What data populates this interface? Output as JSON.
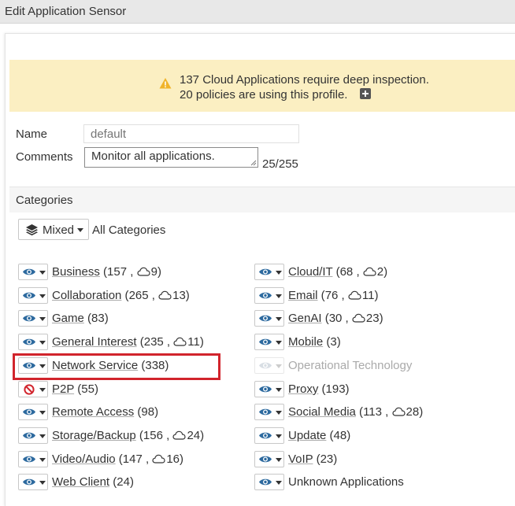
{
  "window": {
    "title": "Edit Application Sensor"
  },
  "banner": {
    "line1": "137 Cloud Applications require deep inspection.",
    "line2": "20 policies are using this profile.",
    "icon": "warning-icon",
    "accent": "#f0b429"
  },
  "form": {
    "name_label": "Name",
    "name_placeholder": "default",
    "comments_label": "Comments",
    "comments_value": "Monitor all applications.",
    "char_count": "25/255"
  },
  "categories": {
    "heading": "Categories",
    "mixed_label": "Mixed",
    "all_label": "All Categories",
    "left": [
      {
        "name": "Business",
        "count": "157",
        "cloud": "9",
        "action": "monitor"
      },
      {
        "name": "Collaboration",
        "count": "265",
        "cloud": "13",
        "action": "monitor"
      },
      {
        "name": "Game",
        "count": "83",
        "action": "monitor"
      },
      {
        "name": "General Interest",
        "count": "235",
        "cloud": "11",
        "action": "monitor"
      },
      {
        "name": "Network Service",
        "count": "338",
        "action": "monitor",
        "highlighted": true
      },
      {
        "name": "P2P",
        "count": "55",
        "action": "block"
      },
      {
        "name": "Remote Access",
        "count": "98",
        "action": "monitor"
      },
      {
        "name": "Storage/Backup",
        "count": "156",
        "cloud": "24",
        "action": "monitor"
      },
      {
        "name": "Video/Audio",
        "count": "147",
        "cloud": "16",
        "action": "monitor"
      },
      {
        "name": "Web Client",
        "count": "24",
        "action": "monitor"
      }
    ],
    "right": [
      {
        "name": "Cloud/IT",
        "count": "68",
        "cloud": "2",
        "action": "monitor"
      },
      {
        "name": "Email",
        "count": "76",
        "cloud": "11",
        "action": "monitor"
      },
      {
        "name": "GenAI",
        "count": "30",
        "cloud": "23",
        "action": "monitor"
      },
      {
        "name": "Mobile",
        "count": "3",
        "action": "monitor"
      },
      {
        "name": "Operational Technology",
        "action": "disabled"
      },
      {
        "name": "Proxy",
        "count": "193",
        "action": "monitor"
      },
      {
        "name": "Social Media",
        "count": "113",
        "cloud": "28",
        "action": "monitor"
      },
      {
        "name": "Update",
        "count": "48",
        "action": "monitor"
      },
      {
        "name": "VoIP",
        "count": "23",
        "action": "monitor"
      },
      {
        "name": "Unknown Applications",
        "action": "monitor",
        "plain": true
      }
    ]
  },
  "colors": {
    "eye": "#2d6a9f",
    "block": "#d1242c",
    "highlight": "#d1242c",
    "banner_bg": "#fbefc2"
  }
}
